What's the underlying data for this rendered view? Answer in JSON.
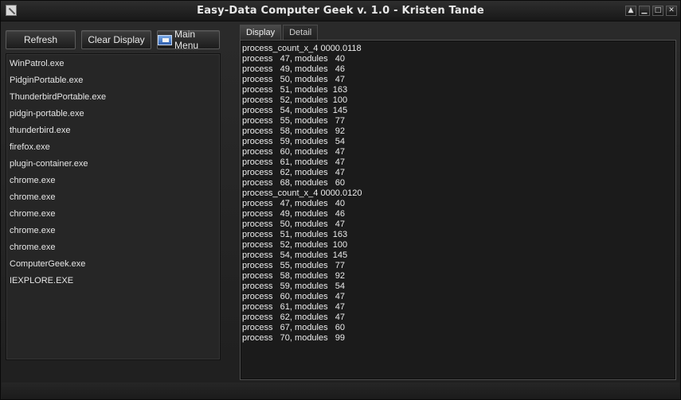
{
  "window": {
    "title": "Easy-Data Computer Geek v. 1.0 - Kristen Tande",
    "controls": [
      "▲",
      "▁",
      "□",
      "✕"
    ]
  },
  "toolbar": {
    "refresh_label": "Refresh",
    "clear_label": "Clear Display",
    "main_menu_label": "Main Menu"
  },
  "process_list": [
    "WinPatrol.exe",
    "PidginPortable.exe",
    "ThunderbirdPortable.exe",
    "pidgin-portable.exe",
    "thunderbird.exe",
    "firefox.exe",
    "plugin-container.exe",
    "chrome.exe",
    "chrome.exe",
    "chrome.exe",
    "chrome.exe",
    "chrome.exe",
    "ComputerGeek.exe",
    "IEXPLORE.EXE"
  ],
  "tabs": [
    {
      "label": "Display",
      "active": true
    },
    {
      "label": "Detail",
      "active": false
    }
  ],
  "display_lines": [
    "process_count_x_4 0000.0118",
    "process   47, modules   40",
    "process   49, modules   46",
    "process   50, modules   47",
    "process   51, modules  163",
    "process   52, modules  100",
    "process   54, modules  145",
    "process   55, modules   77",
    "process   58, modules   92",
    "process   59, modules   54",
    "process   60, modules   47",
    "process   61, modules   47",
    "process   62, modules   47",
    "process   68, modules   60",
    "process_count_x_4 0000.0120",
    "process   47, modules   40",
    "process   49, modules   46",
    "process   50, modules   47",
    "process   51, modules  163",
    "process   52, modules  100",
    "process   54, modules  145",
    "process   55, modules   77",
    "process   58, modules   92",
    "process   59, modules   54",
    "process   60, modules   47",
    "process   61, modules   47",
    "process   62, modules   47",
    "process   67, modules   60",
    "process   70, modules   99"
  ],
  "colors": {
    "background": "#232323",
    "panel": "#1b1b1b",
    "text": "#e6e6e6"
  }
}
